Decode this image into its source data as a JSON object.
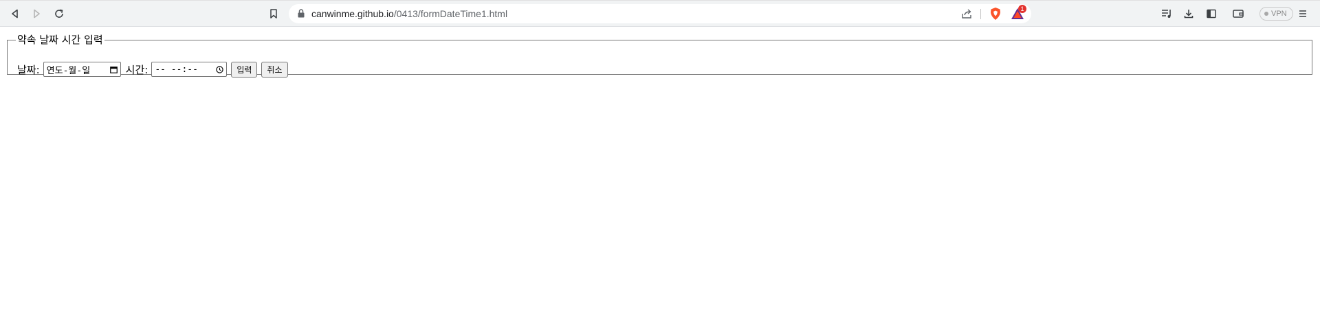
{
  "browser": {
    "url_host": "canwinme.github.io",
    "url_path": "/0413/formDateTime1.html",
    "rewards_badge_count": "1",
    "vpn_label": "VPN",
    "icons": [
      "back-icon",
      "forward-icon",
      "reload-icon",
      "bookmark-icon",
      "lock-icon",
      "share-icon",
      "brave-shields-icon",
      "brave-rewards-icon",
      "playlist-icon",
      "download-icon",
      "sidebar-icon",
      "wallet-icon",
      "menu-icon"
    ]
  },
  "form": {
    "legend": "약속 날짜 시간 입력",
    "date_label": "날짜:",
    "date_placeholder": "연도-월-일",
    "time_label": "시간:",
    "time_placeholder": "-- --:--",
    "submit_label": "입력",
    "reset_label": "취소"
  }
}
